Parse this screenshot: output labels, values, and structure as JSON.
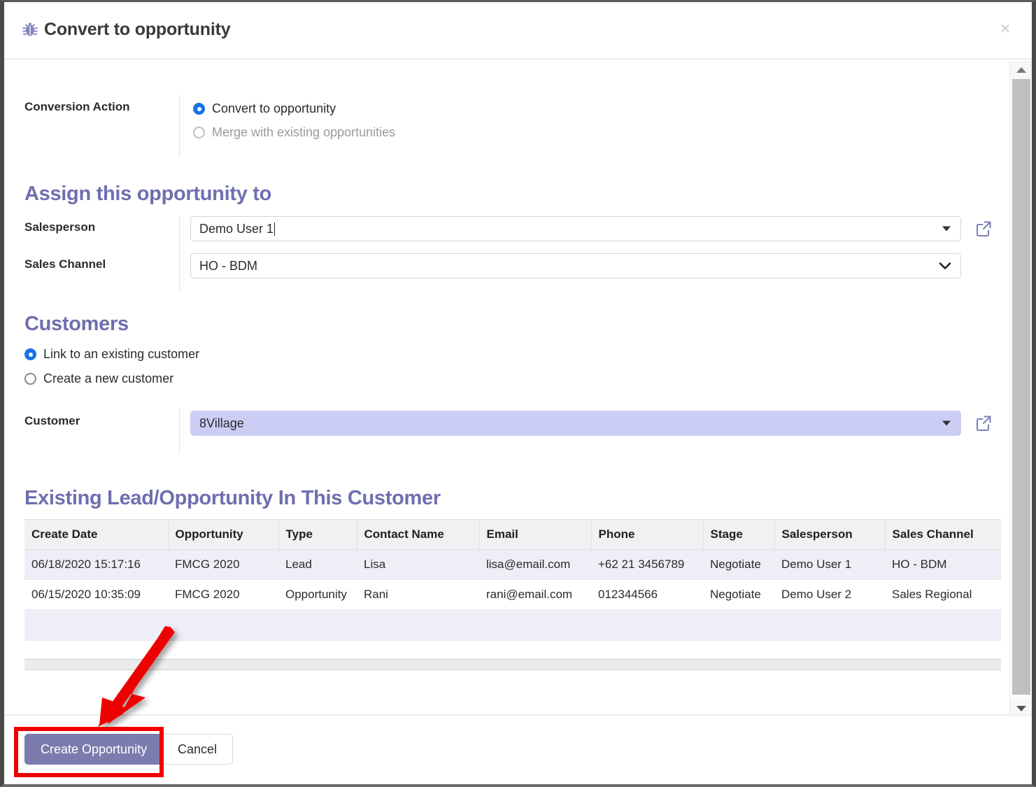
{
  "window": {
    "title": "Convert to opportunity",
    "title_icon": "bug-icon",
    "close_icon": "×"
  },
  "conversion": {
    "label": "Conversion Action",
    "options": [
      {
        "label": "Convert to opportunity",
        "selected": true,
        "disabled": false
      },
      {
        "label": "Merge with existing opportunities",
        "selected": false,
        "disabled": true
      }
    ]
  },
  "assign": {
    "heading": "Assign this opportunity to",
    "salesperson": {
      "label": "Salesperson",
      "value": "Demo User 1",
      "dropdown_icon": "triangle-down-icon",
      "external_icon": "external-link-icon"
    },
    "sales_channel": {
      "label": "Sales Channel",
      "value": "HO - BDM",
      "dropdown_icon": "chevron-down-icon"
    }
  },
  "customers": {
    "heading": "Customers",
    "options": [
      {
        "label": "Link to an existing customer",
        "selected": true
      },
      {
        "label": "Create a new customer",
        "selected": false
      }
    ],
    "customer": {
      "label": "Customer",
      "value": "8Village",
      "dropdown_icon": "triangle-down-icon",
      "external_icon": "external-link-icon"
    }
  },
  "existing": {
    "heading": "Existing Lead/Opportunity In This Customer",
    "columns": [
      "Create Date",
      "Opportunity",
      "Type",
      "Contact Name",
      "Email",
      "Phone",
      "Stage",
      "Salesperson",
      "Sales Channel"
    ],
    "rows": [
      {
        "create_date": "06/18/2020 15:17:16",
        "opportunity": "FMCG 2020",
        "type": "Lead",
        "contact_name": "Lisa",
        "email": "lisa@email.com",
        "phone": "+62 21 3456789",
        "stage": "Negotiate",
        "salesperson": "Demo User 1",
        "sales_channel": "HO - BDM",
        "highlighted": true
      },
      {
        "create_date": "06/15/2020 10:35:09",
        "opportunity": "FMCG 2020",
        "type": "Opportunity",
        "contact_name": "Rani",
        "email": "rani@email.com",
        "phone": "012344566",
        "stage": "Negotiate",
        "salesperson": "Demo User 2",
        "sales_channel": "Sales Regional",
        "highlighted": false
      }
    ]
  },
  "footer": {
    "create_label": "Create Opportunity",
    "cancel_label": "Cancel"
  },
  "scrollbar": {
    "up_icon": "scroll-up-arrow-icon",
    "down_icon": "scroll-down-arrow-icon"
  },
  "colors": {
    "accent_purple": "#6e6eb0",
    "button_purple": "#7b7bae",
    "radio_blue": "#1473e6",
    "lavender_field": "#cccdf5",
    "row_highlight": "#eeeef7",
    "annotation_red": "#ee0000"
  }
}
